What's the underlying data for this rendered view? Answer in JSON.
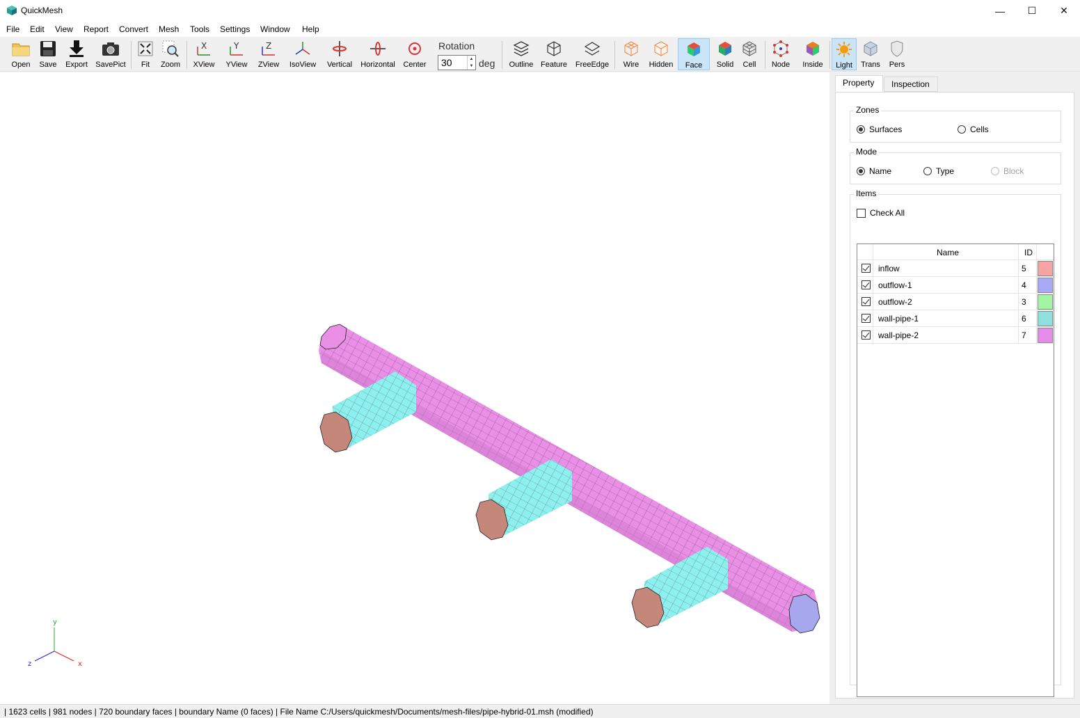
{
  "window": {
    "title": "QuickMesh",
    "min": "—",
    "max": "☐",
    "close": "✕"
  },
  "menu": [
    "File",
    "Edit",
    "View",
    "Report",
    "Convert",
    "Mesh",
    "Tools",
    "Settings",
    "Window",
    "Help"
  ],
  "toolbar": {
    "open": "Open",
    "save": "Save",
    "export": "Export",
    "savepict": "SavePict",
    "fit": "Fit",
    "zoom": "Zoom",
    "xview": "XView",
    "yview": "YView",
    "zview": "ZView",
    "isoview": "IsoView",
    "vertical": "Vertical",
    "horizontal": "Horizontal",
    "center": "Center",
    "rotation_label": "Rotation",
    "rotation_value": "30",
    "rotation_unit": "deg",
    "outline": "Outline",
    "feature": "Feature",
    "freeedge": "FreeEdge",
    "wire": "Wire",
    "hidden": "Hidden",
    "face": "Face",
    "solid": "Solid",
    "cell": "Cell",
    "node": "Node",
    "inside": "Inside",
    "light": "Light",
    "trans": "Trans",
    "pers": "Pers"
  },
  "panel": {
    "tabs": [
      "Property",
      "Inspection"
    ],
    "zones": {
      "title": "Zones",
      "surfaces": "Surfaces",
      "cells": "Cells"
    },
    "mode": {
      "title": "Mode",
      "name": "Name",
      "type": "Type",
      "block": "Block"
    },
    "items": {
      "title": "Items",
      "check_all": "Check All",
      "headers": {
        "name": "Name",
        "id": "ID"
      },
      "rows": [
        {
          "name": "inflow",
          "id": "5",
          "color": "#f5a3a3"
        },
        {
          "name": "outflow-1",
          "id": "4",
          "color": "#a8a8f5"
        },
        {
          "name": "outflow-2",
          "id": "3",
          "color": "#a3f5a3"
        },
        {
          "name": "wall-pipe-1",
          "id": "6",
          "color": "#8fe0dd"
        },
        {
          "name": "wall-pipe-2",
          "id": "7",
          "color": "#e38de8"
        }
      ]
    }
  },
  "axes": {
    "x": "x",
    "y": "y",
    "z": "z"
  },
  "status": "| 1623 cells | 981 nodes | 720 boundary faces |  boundary Name  (0 faces) | File Name C:/Users/quickmesh/Documents/mesh-files/pipe-hybrid-01.msh (modified)"
}
